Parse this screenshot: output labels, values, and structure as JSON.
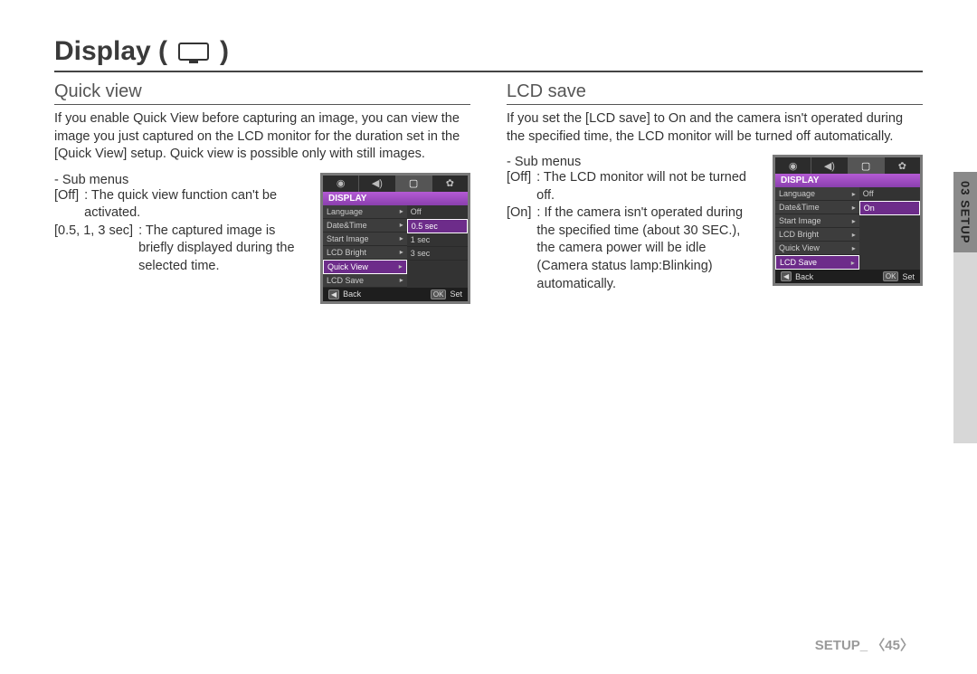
{
  "heading": {
    "title_prefix": "Display (",
    "title_suffix": " )",
    "icon_name": "display-icon"
  },
  "sideTab": {
    "label": "03 SETUP"
  },
  "footer": {
    "label": "SETUP_ 〈45〉"
  },
  "left": {
    "title": "Quick view",
    "para": "If you enable Quick View before capturing an image, you can view the image you just captured on the LCD monitor for the duration set in the [Quick View] setup. Quick view is possible only with still images.",
    "submenus_label": "- Sub menus",
    "items": [
      {
        "key": "[Off]",
        "val": ": The quick view function can't be activated."
      },
      {
        "key": "[0.5, 1, 3 sec]",
        "val": ": The captured image is briefly displayed during the selected time."
      }
    ]
  },
  "right": {
    "title": "LCD save",
    "para": "If you set the [LCD save] to On and the camera isn't operated during the specified time, the LCD monitor will be turned off  automatically.",
    "submenus_label": "- Sub menus",
    "items": [
      {
        "key": "[Off]",
        "val": ": The LCD monitor will not be turned off."
      },
      {
        "key": "[On]",
        "val": ": If the camera isn't operated during the specified time (about 30 SEC.), the camera power will be idle (Camera status lamp:Blinking) automatically."
      }
    ]
  },
  "lcd_common": {
    "title": "DISPLAY",
    "tabs": [
      "camera-icon",
      "sound-icon",
      "display-icon",
      "setup-icon"
    ],
    "left_items": [
      "Language",
      "Date&Time",
      "Start Image",
      "LCD Bright",
      "Quick View",
      "LCD Save"
    ],
    "footer_back_key": "◀",
    "footer_back_label": "Back",
    "footer_ok_key": "OK",
    "footer_ok_label": "Set"
  },
  "lcd_quickview": {
    "selected_left_index": 4,
    "right_items": [
      "Off",
      "0.5 sec",
      "1 sec",
      "3 sec"
    ],
    "selected_right_index": 1
  },
  "lcd_lcdsave": {
    "selected_left_index": 5,
    "right_items": [
      "Off",
      "On"
    ],
    "selected_right_index": 1
  }
}
